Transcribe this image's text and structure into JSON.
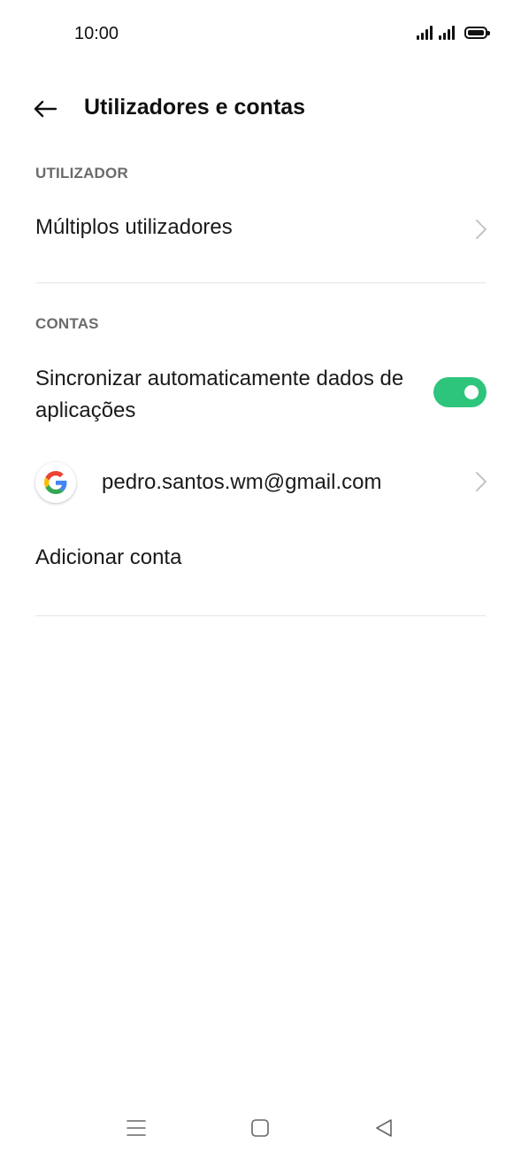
{
  "status_bar": {
    "time": "10:00"
  },
  "header": {
    "title": "Utilizadores e contas"
  },
  "sections": {
    "user_label": "UTILIZADOR",
    "accounts_label": "CONTAS"
  },
  "rows": {
    "multiple_users": "Múltiplos utilizadores",
    "auto_sync": "Sincronizar automaticamente dados de aplicações",
    "auto_sync_enabled": true,
    "google_account": "pedro.santos.wm@gmail.com",
    "add_account": "Adicionar conta"
  },
  "colors": {
    "toggle_on": "#2dc57c"
  }
}
